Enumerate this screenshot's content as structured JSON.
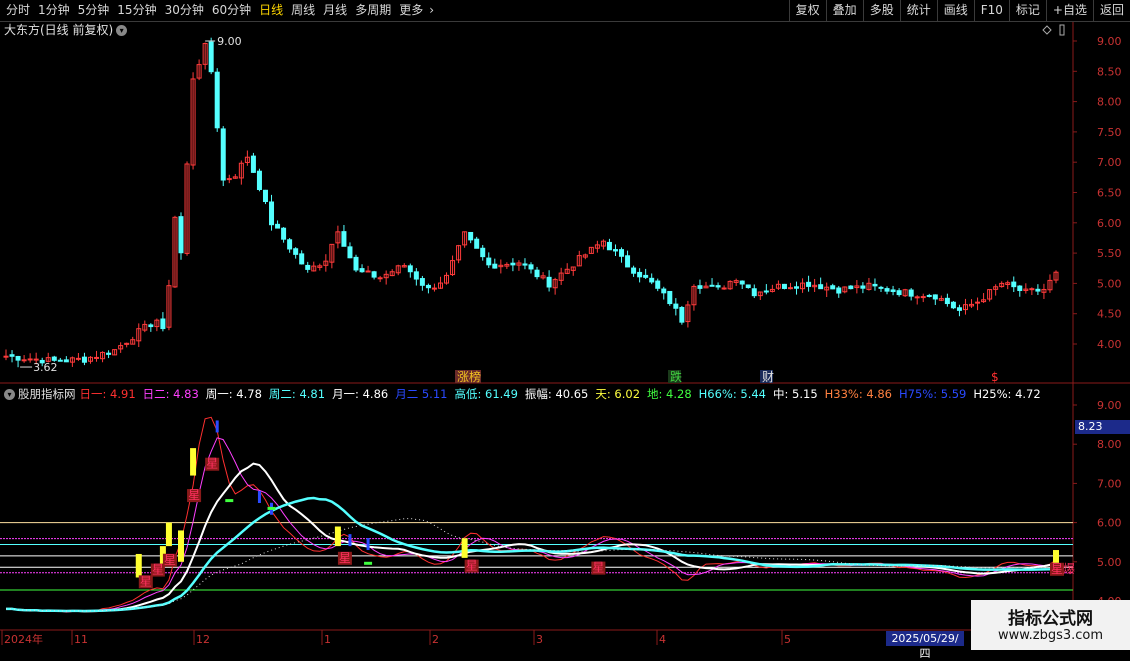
{
  "toolbar": {
    "timeframes": [
      "分时",
      "1分钟",
      "5分钟",
      "15分钟",
      "30分钟",
      "60分钟",
      "日线",
      "周线",
      "月线",
      "多周期",
      "更多"
    ],
    "active_index": 6,
    "more_chevron": "›",
    "right_buttons": [
      "复权",
      "叠加",
      "多股",
      "统计",
      "画线",
      "F10",
      "标记",
      "+自选",
      "返回"
    ]
  },
  "main_chart": {
    "title": "大东方(日线 前复权)",
    "title_icon": "chevron-down-icon",
    "y_ticks": [
      9.0,
      8.5,
      8.0,
      7.5,
      7.0,
      6.5,
      6.0,
      5.5,
      5.0,
      4.5,
      4.0
    ],
    "y_tick_labels": [
      "9.00",
      "8.50",
      "8.00",
      "7.50",
      "7.00",
      "6.50",
      "6.00",
      "5.50",
      "5.00",
      "4.50",
      "4.00"
    ],
    "high_label": "9.00",
    "low_label": "3.62",
    "event_labels": [
      {
        "text": "涨榜",
        "color": "#f0c020",
        "bg": "#6a2a2a"
      },
      {
        "text": "跌",
        "color": "#40d040",
        "bg": "#1a3a1a"
      },
      {
        "text": "财",
        "color": "#e0e0e0",
        "bg": "#1a2a5a"
      },
      {
        "text": "$",
        "color": "#ff3030",
        "bg": ""
      }
    ],
    "up_color": "#ff3b3b",
    "down_color": "#54ffff"
  },
  "indicator": {
    "name": "股朋指标网",
    "values": [
      {
        "label": "日一:",
        "value": "4.91",
        "color": "#ff3030"
      },
      {
        "label": "日二:",
        "value": "4.83",
        "color": "#ff40ff"
      },
      {
        "label": "周一:",
        "value": "4.78",
        "color": "#ffffff"
      },
      {
        "label": "周二:",
        "value": "4.81",
        "color": "#54ffff"
      },
      {
        "label": "月一:",
        "value": "4.86",
        "color": "#ffffff"
      },
      {
        "label": "月二",
        "value": "5.11",
        "color": "#2a4aff"
      },
      {
        "label": "高低:",
        "value": "61.49",
        "color": "#54ffff"
      },
      {
        "label": "振幅:",
        "value": "40.65",
        "color": "#ffffff"
      },
      {
        "label": "天:",
        "value": "6.02",
        "color": "#ffff40"
      },
      {
        "label": "地:",
        "value": "4.28",
        "color": "#40ff40"
      },
      {
        "label": "H66%:",
        "value": "5.44",
        "color": "#54ffff"
      },
      {
        "label": "中:",
        "value": "5.15",
        "color": "#ffffff"
      },
      {
        "label": "H33%:",
        "value": "4.86",
        "color": "#ff8040"
      },
      {
        "label": "H75%:",
        "value": "5.59",
        "color": "#2a4aff"
      },
      {
        "label": "H25%:",
        "value": "4.72",
        "color": "#ffffff"
      }
    ],
    "y_ticks": [
      9.0,
      8.0,
      7.0,
      6.0,
      5.0,
      4.0
    ],
    "y_tick_labels": [
      "9.00",
      "8.00",
      "7.00",
      "6.00",
      "5.00",
      "4.00"
    ],
    "current_price_tag": "8.23",
    "star_label": "星",
    "last_label": "星爆"
  },
  "x_axis": {
    "labels": [
      "2024年",
      "11",
      "12",
      "1",
      "2",
      "3",
      "4",
      "5"
    ],
    "cursor_date": "2025/05/29/四"
  },
  "watermark": {
    "title": "指标公式网",
    "url": "www.zbgs3.com"
  }
}
